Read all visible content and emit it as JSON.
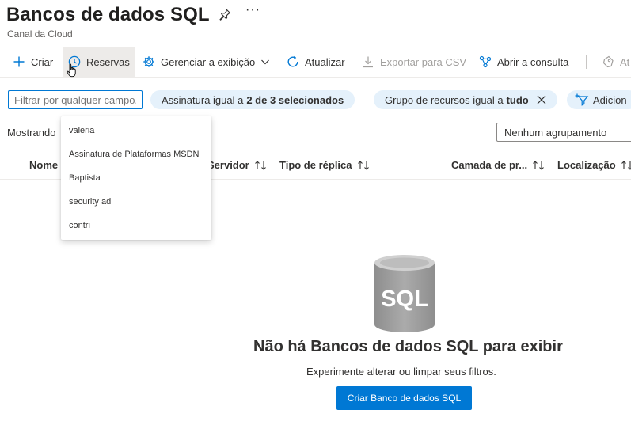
{
  "header": {
    "title": "Bancos de dados SQL",
    "subtitle": "Canal da Cloud",
    "more_label": "···"
  },
  "toolbar": {
    "create_label": "Criar",
    "reservations_label": "Reservas",
    "manage_view_label": "Gerenciar a exibição",
    "refresh_label": "Atualizar",
    "export_csv_label": "Exportar para CSV",
    "open_query_label": "Abrir a consulta",
    "truncated_label": "At"
  },
  "filters": {
    "search_placeholder": "Filtrar por qualquer campo...",
    "subscription_prefix": "Assinatura igual a",
    "subscription_value": "2 de 3 selecionados",
    "resource_group_prefix": "Grupo de recursos igual a",
    "resource_group_value": "tudo",
    "add_filter_label": "Adicion"
  },
  "results": {
    "showing_label": "Mostrando",
    "grouping_value": "Nenhum agrupamento"
  },
  "columns": {
    "name": "Nome",
    "server": "Servidor",
    "replica_type": "Tipo de réplica",
    "pricing_tier": "Camada de pr...",
    "location": "Localização"
  },
  "dropdown": {
    "items": [
      "valeria",
      "Assinatura de Plataformas MSDN",
      "Baptista",
      "security ad",
      "contri"
    ]
  },
  "empty_state": {
    "icon_text": "SQL",
    "title": "Não há Bancos de dados SQL para exibir",
    "subtitle": "Experimente alterar ou limpar seus filtros.",
    "cta_label": "Criar Banco de dados SQL"
  },
  "colors": {
    "accent": "#0078d4",
    "pill_bg": "#e5f1fb",
    "db_icon": "#a0a0a0"
  }
}
